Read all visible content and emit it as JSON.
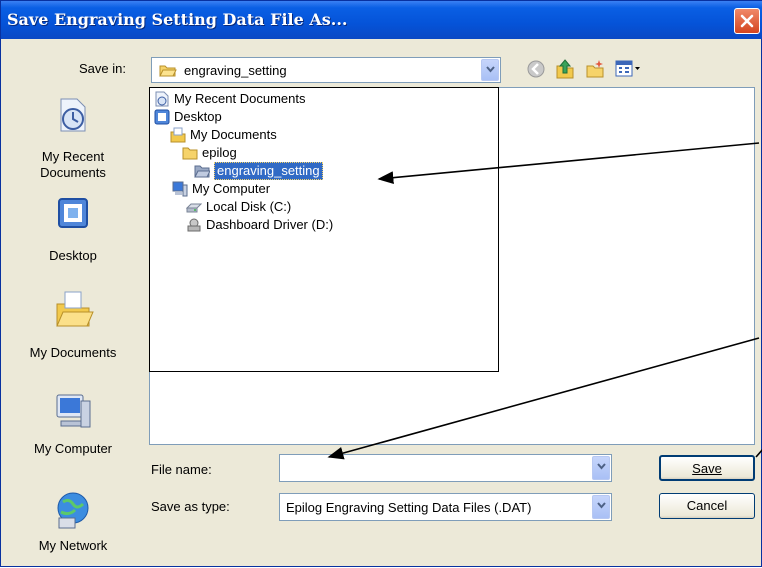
{
  "window": {
    "title": "Save Engraving Setting Data File As..."
  },
  "header": {
    "save_in_label": "Save in:",
    "save_in_value": "engraving_setting",
    "toolbar_icons": [
      "back-icon",
      "up-folder-icon",
      "new-folder-icon",
      "views-menu-icon"
    ]
  },
  "places_bar": [
    {
      "label_lines": [
        "My Recent",
        "Documents"
      ],
      "icon": "recent-documents-icon"
    },
    {
      "label_lines": [
        "Desktop"
      ],
      "icon": "desktop-icon"
    },
    {
      "label_lines": [
        "My Documents"
      ],
      "icon": "my-documents-icon"
    },
    {
      "label_lines": [
        "My Computer"
      ],
      "icon": "my-computer-icon"
    },
    {
      "label_lines": [
        "My Network"
      ],
      "icon": "my-network-icon"
    }
  ],
  "save_in_dropdown": {
    "items": [
      {
        "label": "My Recent Documents",
        "icon": "recent-documents-icon",
        "level": 0,
        "selected": false
      },
      {
        "label": "Desktop",
        "icon": "desktop-icon",
        "level": 0,
        "selected": false
      },
      {
        "label": "My Documents",
        "icon": "my-documents-icon",
        "level": 1,
        "selected": false
      },
      {
        "label": "epilog",
        "icon": "folder-icon",
        "level": 2,
        "selected": false
      },
      {
        "label": "engraving_setting",
        "icon": "open-folder-icon",
        "level": 3,
        "selected": true
      },
      {
        "label": "My Computer",
        "icon": "my-computer-icon",
        "level": 1,
        "selected": false
      },
      {
        "label": "Local Disk (C:)",
        "icon": "local-disk-icon",
        "level": 2,
        "selected": false
      },
      {
        "label": "Dashboard Driver (D:)",
        "icon": "removable-drive-icon",
        "level": 2,
        "selected": false
      }
    ]
  },
  "form": {
    "file_name_label": "File name:",
    "file_name_value": "",
    "save_as_type_label": "Save as type:",
    "save_as_type_value": "Epilog Engraving Setting Data Files (.DAT)"
  },
  "buttons": {
    "save": "Save",
    "cancel": "Cancel"
  },
  "colors": {
    "title_bar": "#0553d8",
    "dialog_background": "#ECE9D8",
    "selection": "#316ac5",
    "close_button": "#d4451f"
  }
}
